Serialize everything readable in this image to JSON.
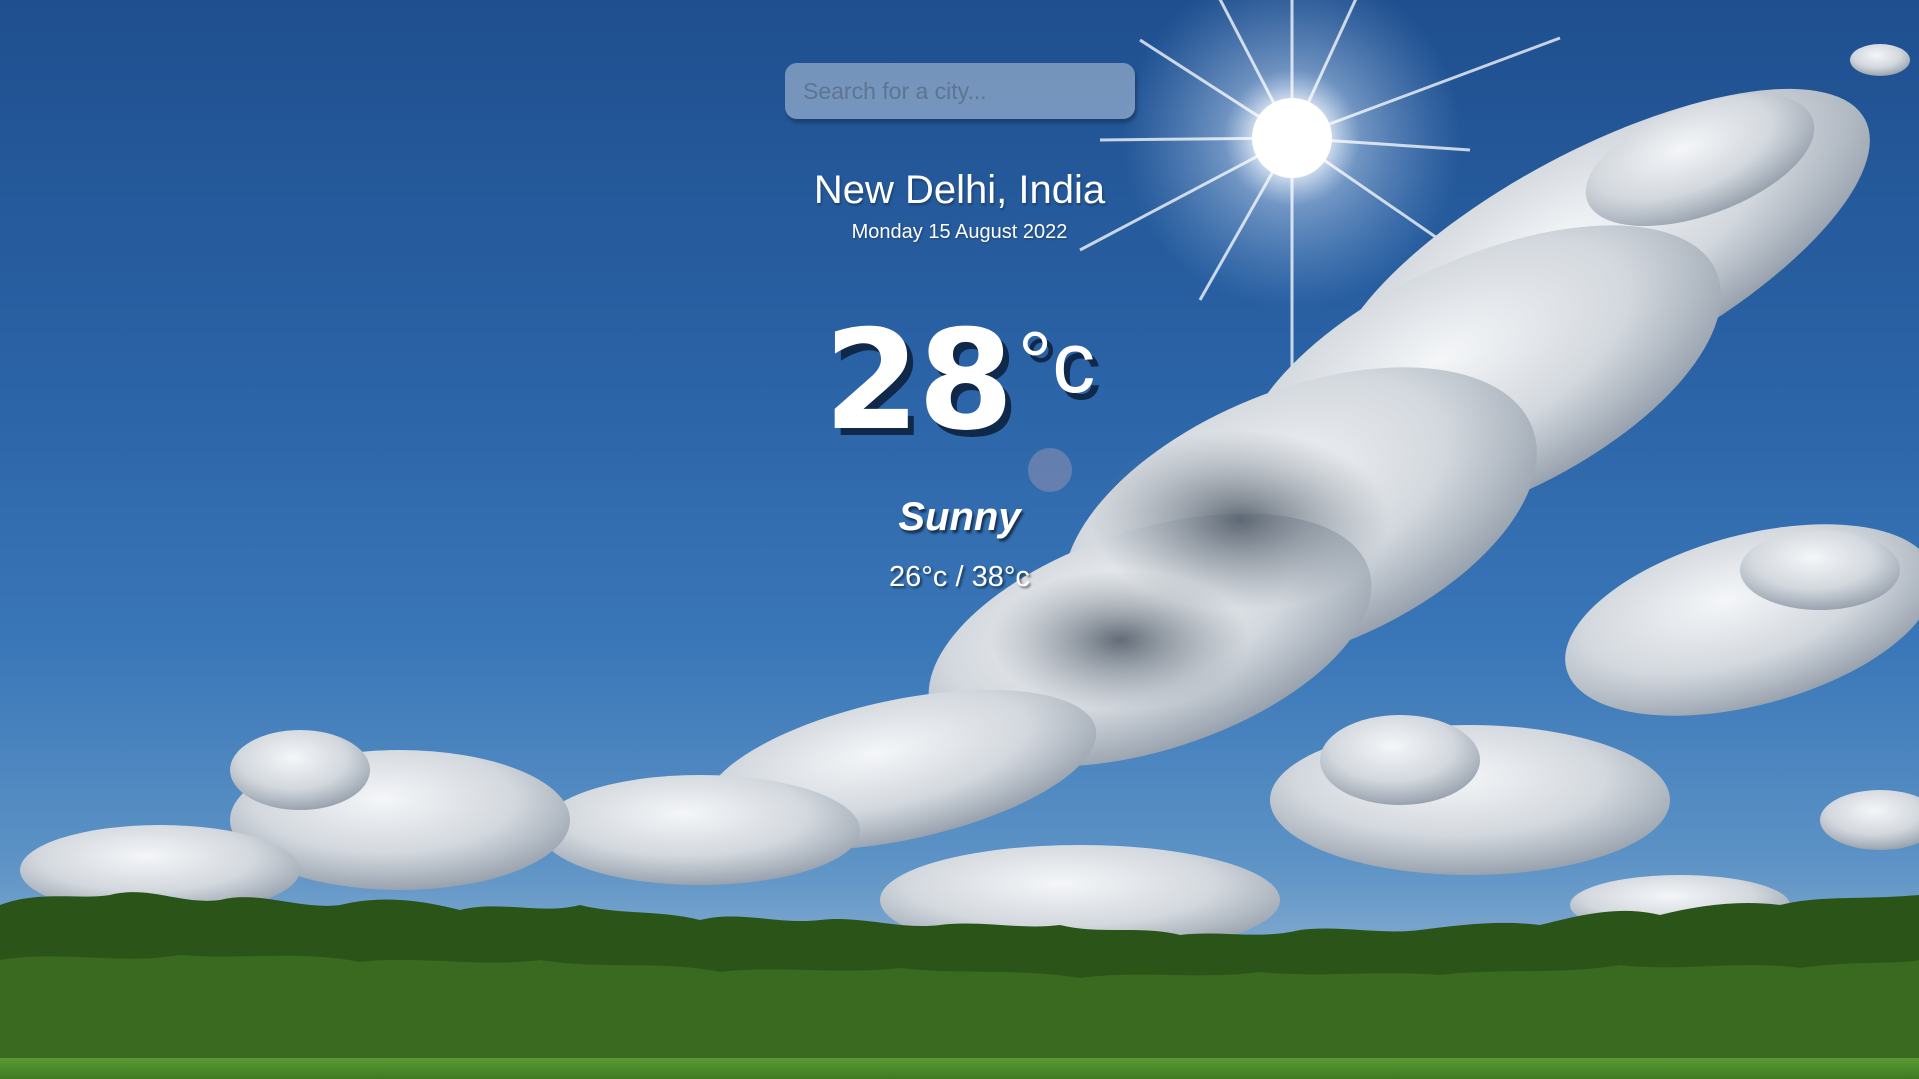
{
  "search": {
    "placeholder": "Search for a city..."
  },
  "location": {
    "city": "New Delhi, India",
    "date": "Monday 15 August 2022"
  },
  "weather": {
    "temperature": "28",
    "unit": "°c",
    "condition": "Sunny",
    "range": "26°c / 38°c"
  },
  "background": {
    "scene": "sunny sky with clouds over tree line and grass field",
    "sky_color": "#2a63a6",
    "tree_color": "#2f5a1c",
    "grass_color": "#4a8a2a"
  },
  "colors": {
    "text": "#ffffff",
    "shadow": "#0c1e3a"
  }
}
